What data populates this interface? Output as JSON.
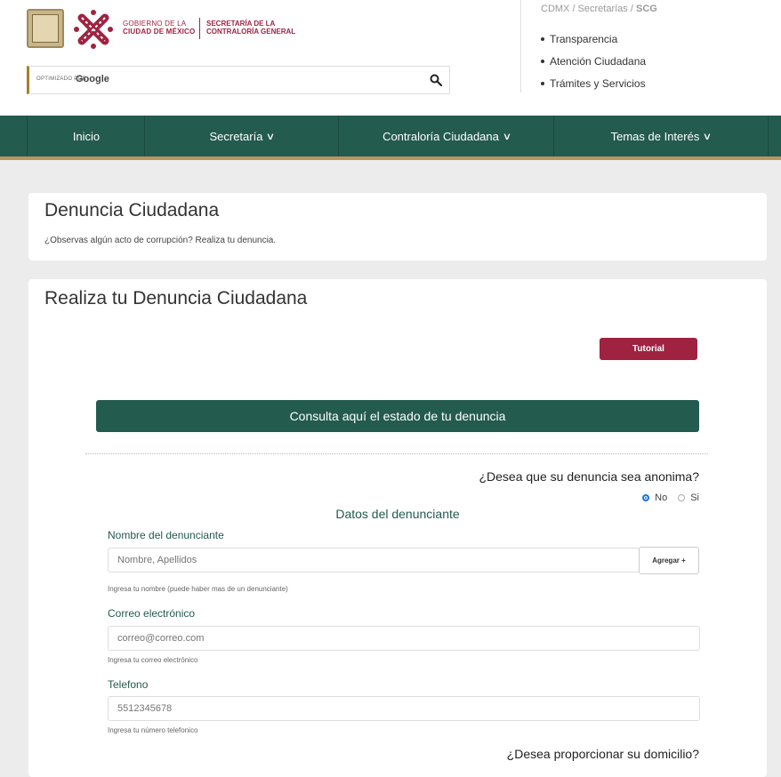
{
  "header": {
    "gov_line1": "GOBIERNO DE LA",
    "gov_line2": "CIUDAD DE MÉXICO",
    "secretaria_line1": "SECRETARÍA DE LA",
    "secretaria_line2": "CONTRALORÍA GENERAL",
    "search_prefix": "OPTIMIZADO POR",
    "search_brand": "Google",
    "breadcrumb": "CDMX / Secretarías / ",
    "breadcrumb_current": "SCG",
    "quick_links": [
      "Transparencia",
      "Atención Ciudadana",
      "Trámites y Servicios"
    ]
  },
  "nav": {
    "items": [
      {
        "label": "Inicio",
        "dropdown": false
      },
      {
        "label": "Secretaría",
        "dropdown": true
      },
      {
        "label": "Contraloría Ciudadana",
        "dropdown": true
      },
      {
        "label": "Temas de Interés",
        "dropdown": true
      }
    ]
  },
  "intro": {
    "title": "Denuncia Ciudadana",
    "subtitle": "¿Observas algún acto de corrupción? Realiza tu denuncia."
  },
  "form": {
    "title": "Realiza tu Denuncia Ciudadana",
    "tutorial_label": "Tutorial",
    "consulta_label": "Consulta aquí el estado de tu denuncia",
    "anon_question": "¿Desea que su denuncia sea anonima?",
    "anon_no": "No",
    "anon_si": "Si",
    "anon_selected": "No",
    "section_title": "Datos del denunciante",
    "nombre_label": "Nombre del denunciante",
    "nombre_placeholder": "Nombre, Apellidos",
    "agregar_label": "Agregar +",
    "nombre_help": "Ingresa tu nombre (puede haber mas de un denunciante)",
    "correo_label": "Correo electrónico",
    "correo_placeholder": "correo@correo.com",
    "correo_help": "Ingresa tu correo electrónico",
    "telefono_label": "Telefono",
    "telefono_placeholder": "5512345678",
    "telefono_help": "Ingresa tu número telefonico",
    "domicilio_question": "¿Desea proporcionar su domicilio?"
  },
  "colors": {
    "brand_green": "#235b4e",
    "brand_wine": "#9f2241",
    "brand_gold": "#bc955c"
  }
}
